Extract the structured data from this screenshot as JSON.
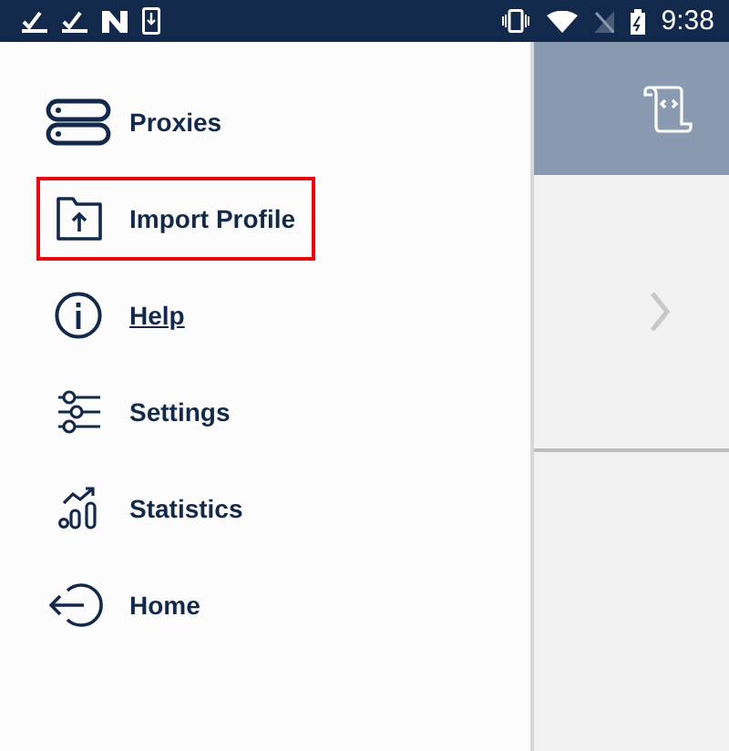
{
  "status_bar": {
    "time": "9:38"
  },
  "drawer": {
    "items": [
      {
        "label": "Proxies",
        "selected": false,
        "underlined": false
      },
      {
        "label": "Import Profile",
        "selected": true,
        "underlined": false
      },
      {
        "label": "Help",
        "selected": false,
        "underlined": true
      },
      {
        "label": "Settings",
        "selected": false,
        "underlined": false
      },
      {
        "label": "Statistics",
        "selected": false,
        "underlined": false
      },
      {
        "label": "Home",
        "selected": false,
        "underlined": false
      }
    ]
  }
}
